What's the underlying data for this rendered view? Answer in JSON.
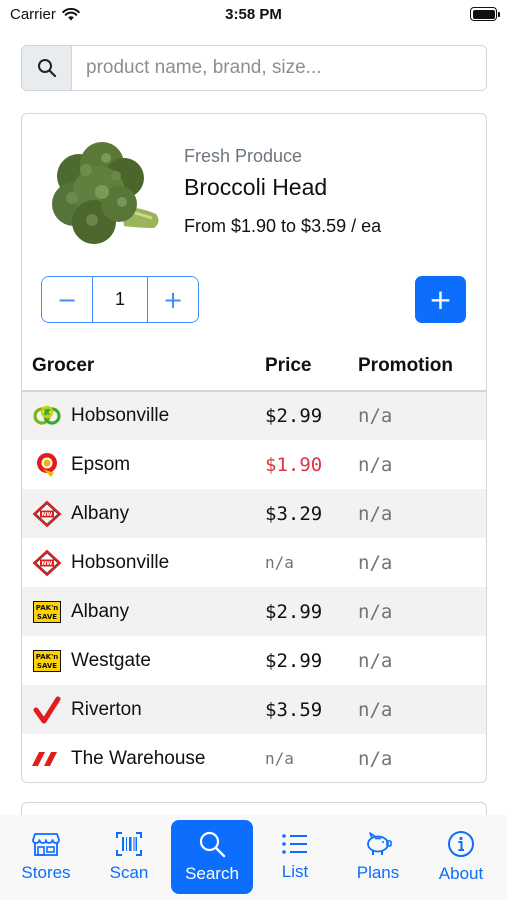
{
  "status_bar": {
    "carrier": "Carrier",
    "time": "3:58 PM"
  },
  "search": {
    "placeholder": "product name, brand, size...",
    "value": ""
  },
  "product": {
    "category": "Fresh Produce",
    "name": "Broccoli Head",
    "price_range": "From $1.90 to $3.59 / ea",
    "quantity": "1",
    "decrement_label": "−",
    "increment_label": "+",
    "add_label": "+"
  },
  "table": {
    "headers": {
      "grocer": "Grocer",
      "price": "Price",
      "promotion": "Promotion"
    },
    "rows": [
      {
        "logo": "countdown-logo",
        "grocer": "Hobsonville",
        "price": "$2.99",
        "promotion": "n/a"
      },
      {
        "logo": "new-world-q-logo",
        "grocer": "Epsom",
        "price": "$1.90",
        "promotion": "n/a"
      },
      {
        "logo": "new-world-logo",
        "grocer": "Albany",
        "price": "$3.29",
        "promotion": "n/a"
      },
      {
        "logo": "new-world-logo",
        "grocer": "Hobsonville",
        "price": "n/a",
        "promotion": "n/a"
      },
      {
        "logo": "paknsave-logo",
        "grocer": "Albany",
        "price": "$2.99",
        "promotion": "n/a"
      },
      {
        "logo": "paknsave-logo",
        "grocer": "Westgate",
        "price": "$2.99",
        "promotion": "n/a"
      },
      {
        "logo": "fresh-choice-logo",
        "grocer": "Riverton",
        "price": "$3.59",
        "promotion": "n/a"
      },
      {
        "logo": "the-warehouse-logo",
        "grocer": "The Warehouse",
        "price": "n/a",
        "promotion": "n/a"
      }
    ]
  },
  "tabs": [
    {
      "label": "Stores",
      "icon": "store-icon"
    },
    {
      "label": "Scan",
      "icon": "barcode-icon"
    },
    {
      "label": "Search",
      "icon": "search-icon",
      "active": true
    },
    {
      "label": "List",
      "icon": "list-icon"
    },
    {
      "label": "Plans",
      "icon": "piggy-bank-icon"
    },
    {
      "label": "About",
      "icon": "info-icon"
    }
  ],
  "colors": {
    "accent": "#0d6efd",
    "lowest_price": "#dc3545",
    "muted": "#6c757d"
  }
}
